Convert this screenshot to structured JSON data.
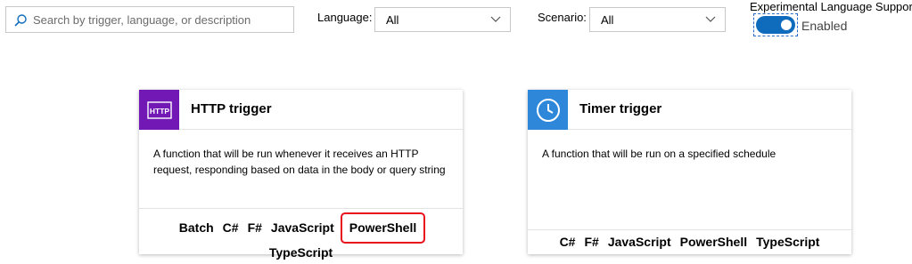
{
  "search": {
    "placeholder": "Search by trigger, language, or description",
    "value": ""
  },
  "filters": {
    "language": {
      "label": "Language:",
      "value": "All"
    },
    "scenario": {
      "label": "Scenario:",
      "value": "All"
    }
  },
  "experimental": {
    "label": "Experimental Language Support:",
    "state": "Enabled",
    "on": true
  },
  "cards": {
    "http": {
      "title": "HTTP trigger",
      "icon": "http-icon",
      "icon_text": "HTTP",
      "icon_color": "#7219b5",
      "description": "A function that will be run whenever it receives an HTTP request, responding based on data in the body or query string",
      "languages": [
        "Batch",
        "C#",
        "F#",
        "JavaScript",
        "PowerShell",
        "TypeScript"
      ],
      "highlighted": "PowerShell"
    },
    "timer": {
      "title": "Timer trigger",
      "icon": "clock-icon",
      "icon_color": "#2f87d9",
      "description": "A function that will be run on a specified schedule",
      "languages": [
        "C#",
        "F#",
        "JavaScript",
        "PowerShell",
        "TypeScript"
      ]
    }
  },
  "colors": {
    "accent": "#0f6cbd",
    "highlight_border": "#e8101a"
  }
}
